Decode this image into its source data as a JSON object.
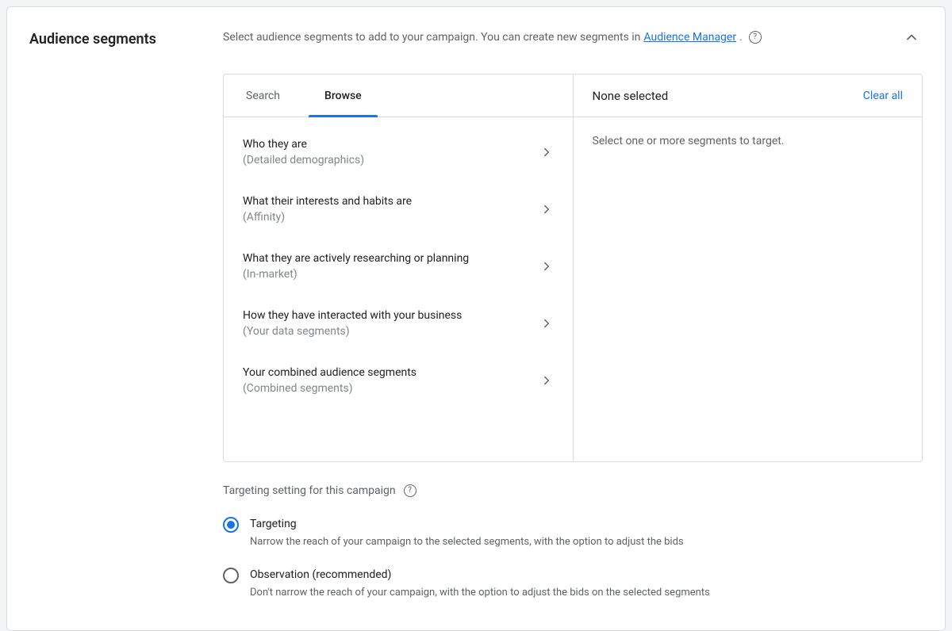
{
  "section_title": "Audience segments",
  "intro": {
    "text_before_link": "Select audience segments to add to your campaign. You can create new segments in ",
    "link_text": "Audience Manager",
    "text_after_link": "."
  },
  "tabs": {
    "search": "Search",
    "browse": "Browse",
    "active": "browse"
  },
  "browse_items": [
    {
      "title": "Who they are",
      "sub": "(Detailed demographics)"
    },
    {
      "title": "What their interests and habits are",
      "sub": "(Affinity)"
    },
    {
      "title": "What they are actively researching or planning",
      "sub": "(In-market)"
    },
    {
      "title": "How they have interacted with your business",
      "sub": "(Your data segments)"
    },
    {
      "title": "Your combined audience segments",
      "sub": "(Combined segments)"
    }
  ],
  "selected_panel": {
    "header": "None selected",
    "clear_all": "Clear all",
    "empty_message": "Select one or more segments to target."
  },
  "targeting": {
    "label": "Targeting setting for this campaign",
    "options": [
      {
        "id": "targeting",
        "title": "Targeting",
        "desc": "Narrow the reach of your campaign to the selected segments, with the option to adjust the bids",
        "checked": true
      },
      {
        "id": "observation",
        "title": "Observation (recommended)",
        "desc": "Don't narrow the reach of your campaign, with the option to adjust the bids on the selected segments",
        "checked": false
      }
    ]
  }
}
